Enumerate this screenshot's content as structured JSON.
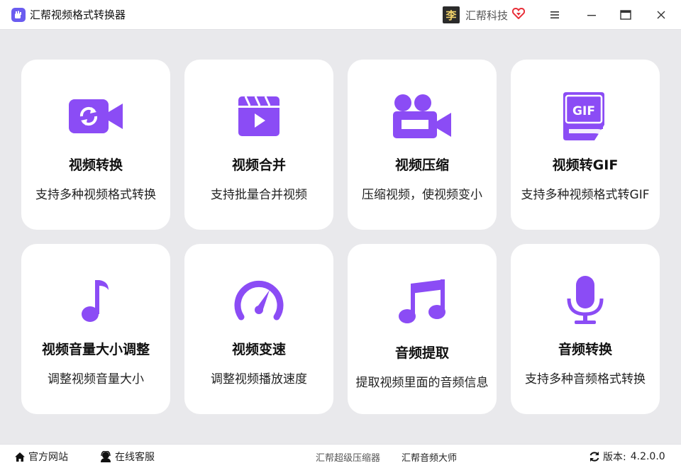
{
  "app": {
    "title": "汇帮视频格式转换器"
  },
  "brand": {
    "name": "汇帮科技",
    "avatar_glyph": "李"
  },
  "colors": {
    "accent": "#8b4cf5",
    "heart": "#e8303a",
    "logo": "#6a5cf0"
  },
  "cards": [
    {
      "title": "视频转换",
      "desc": "支持多种视频格式转换",
      "icon": "video-convert-icon"
    },
    {
      "title": "视频合并",
      "desc": "支持批量合并视频",
      "icon": "clapperboard-play-icon"
    },
    {
      "title": "视频压缩",
      "desc": "压缩视频，使视频变小",
      "icon": "movie-camera-icon"
    },
    {
      "title": "视频转GIF",
      "desc": "支持多种视频格式转GIF",
      "icon": "gif-file-icon",
      "icon_text": "GIF"
    },
    {
      "title": "视频音量大小调整",
      "desc": "调整视频音量大小",
      "icon": "music-note-icon"
    },
    {
      "title": "视频变速",
      "desc": "调整视频播放速度",
      "icon": "speedometer-icon"
    },
    {
      "title": "音频提取",
      "desc": "提取视频里面的音频信息",
      "icon": "music-notes-icon"
    },
    {
      "title": "音频转换",
      "desc": "支持多种音频格式转换",
      "icon": "microphone-icon"
    }
  ],
  "footer": {
    "website": "官方网站",
    "support": "在线客服",
    "link1": "汇帮超级压缩器",
    "link2": "汇帮音频大师",
    "version_label": "版本:",
    "version": "4.2.0.0"
  }
}
